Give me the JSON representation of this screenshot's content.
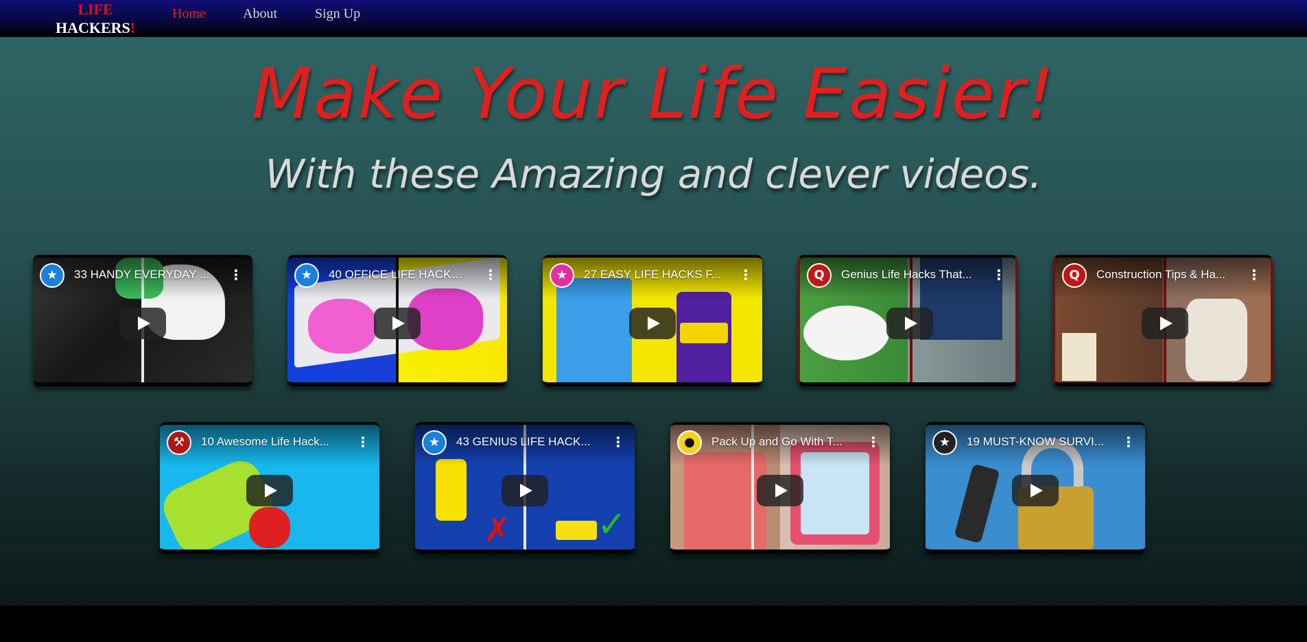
{
  "nav": {
    "logo_line1": "LIFE",
    "logo_line2": "HACKERS",
    "logo_bang": "!",
    "links": [
      "Home",
      "About",
      "Sign Up"
    ]
  },
  "hero": {
    "title": "Make Your Life Easier!",
    "subtitle": "With these Amazing and clever videos."
  },
  "videos": [
    {
      "title": "33 HANDY EVERYDAY ...",
      "channel_icon": "lightbulb-icon"
    },
    {
      "title": "40 OFFICE LIFE HACKS...",
      "channel_icon": "lightbulb-icon"
    },
    {
      "title": "27 EASY LIFE HACKS F...",
      "channel_icon": "lightbulb-icon"
    },
    {
      "title": "Genius Life Hacks That...",
      "channel_icon": "q-logo-icon"
    },
    {
      "title": "Construction Tips & Ha...",
      "channel_icon": "q-logo-icon"
    },
    {
      "title": "10 Awesome Life Hack...",
      "channel_icon": "wrench-logo-icon"
    },
    {
      "title": "43 GENIUS LIFE HACK...",
      "channel_icon": "lightbulb-icon"
    },
    {
      "title": "Pack Up and Go With T...",
      "channel_icon": "panda-icon"
    },
    {
      "title": "19 MUST-KNOW SURVI...",
      "channel_icon": "lightbulb-icon"
    }
  ],
  "colors": {
    "accent_red": "#e21f1f",
    "nav_blue": "#0f0f78",
    "bg_teal": "#2f6464"
  }
}
